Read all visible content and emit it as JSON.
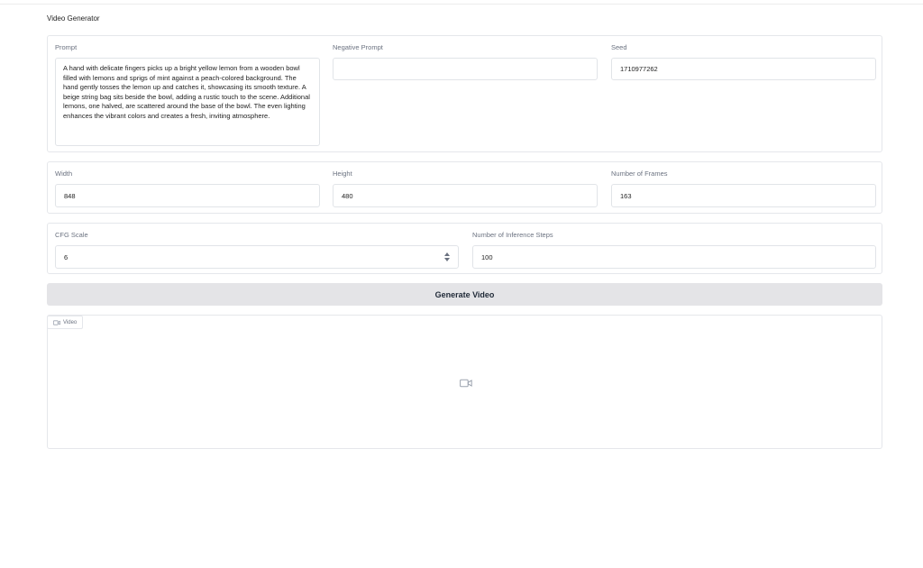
{
  "app": {
    "title": "Video Generator"
  },
  "prompt": {
    "label": "Prompt",
    "value": "A hand with delicate fingers picks up a bright yellow lemon from a wooden bowl filled with lemons and sprigs of mint against a peach-colored background. The hand gently tosses the lemon up and catches it, showcasing its smooth texture. A beige string bag sits beside the bowl, adding a rustic touch to the scene. Additional lemons, one halved, are scattered around the base of the bowl. The even lighting enhances the vibrant colors and creates a fresh, inviting atmosphere."
  },
  "negative_prompt": {
    "label": "Negative Prompt",
    "value": ""
  },
  "seed": {
    "label": "Seed",
    "value": "1710977262"
  },
  "width": {
    "label": "Width",
    "value": "848"
  },
  "height": {
    "label": "Height",
    "value": "480"
  },
  "frames": {
    "label": "Number of Frames",
    "value": "163"
  },
  "cfg": {
    "label": "CFG Scale",
    "value": "6"
  },
  "steps": {
    "label": "Number of Inference Steps",
    "value": "100"
  },
  "generate": {
    "label": "Generate Video"
  },
  "video": {
    "tab_label": "Video",
    "icon": "video-camera-icon"
  },
  "colors": {
    "button_bg": "#e4e4e7",
    "border": "#e5e7eb"
  }
}
